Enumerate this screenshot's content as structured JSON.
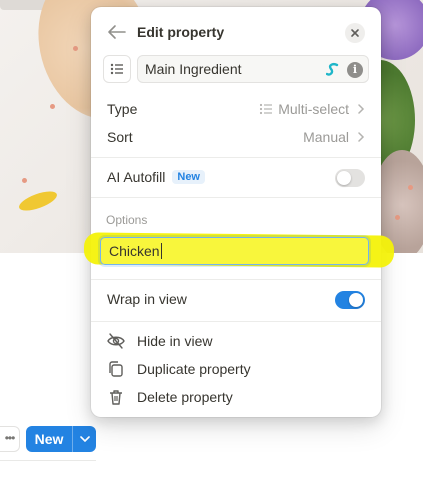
{
  "panel": {
    "title": "Edit property",
    "property_name": "Main Ingredient",
    "type_label": "Type",
    "type_value": "Multi-select",
    "sort_label": "Sort",
    "sort_value": "Manual",
    "ai_autofill_label": "AI Autofill",
    "ai_autofill_badge": "New",
    "ai_autofill_enabled": false,
    "options_label": "Options",
    "option_input_value": "Chicken",
    "wrap_label": "Wrap in view",
    "wrap_enabled": true,
    "actions": [
      {
        "label": "Hide in view",
        "icon": "eye-slash-icon"
      },
      {
        "label": "Duplicate property",
        "icon": "duplicate-icon"
      },
      {
        "label": "Delete property",
        "icon": "trash-icon"
      }
    ]
  },
  "toolbar": {
    "more_label": "•••",
    "new_label": "New"
  },
  "colors": {
    "accent": "#2383e2",
    "highlight": "#f4f20a",
    "text": "#37352f",
    "muted": "#9b9a97"
  }
}
